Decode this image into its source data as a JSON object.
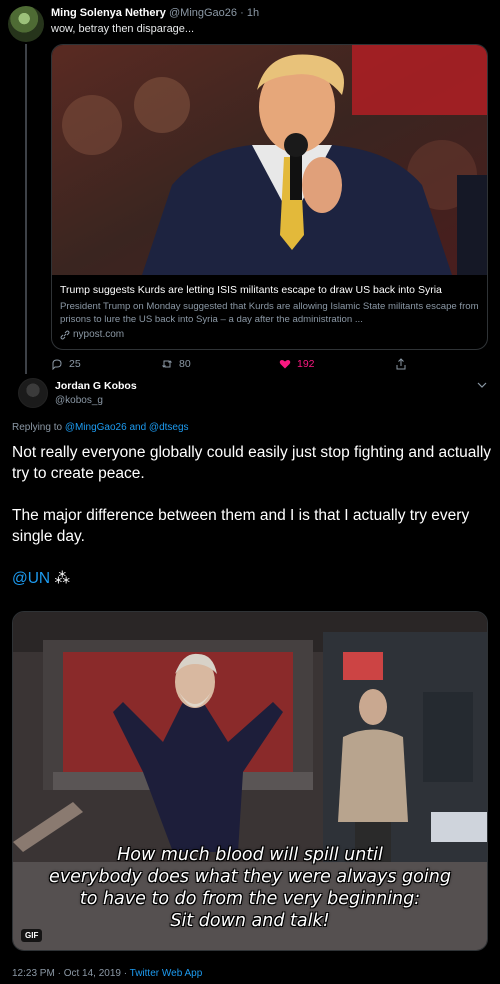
{
  "tweet1": {
    "name": "Ming Solenya Nethery",
    "handle": "@MingGao26",
    "time": "1h",
    "separator": "·",
    "text": "wow, betray then disparage...",
    "card": {
      "title": "Trump suggests Kurds are letting ISIS militants escape to draw US back into Syria",
      "description": "President Trump on Monday suggested that Kurds are allowing Islamic State militants escape from prisons to lure the US back into Syria – a day after the administration ...",
      "domain": "nypost.com"
    },
    "stats": {
      "replies": "25",
      "retweets": "80",
      "likes": "192"
    }
  },
  "tweet2": {
    "name": "Jordan G Kobos",
    "handle": "@kobos_g",
    "replying_prefix": "Replying to ",
    "replying_to_1": "@MingGao26",
    "replying_and": " and ",
    "replying_to_2": "@dtsegs",
    "text_p1": "Not really everyone globally could easily just stop fighting and actually try to create peace.",
    "text_p2": "The major difference between them and I is that I actually try every single day.",
    "mention": "@UN",
    "emoji": "⁂",
    "gif_caption_1": "How much blood will spill until",
    "gif_caption_2": "everybody does what they were always going",
    "gif_caption_3": "to have to do from the very beginning:",
    "gif_caption_4": "Sit down and talk!",
    "gif_badge": "GIF",
    "timestamp": "12:23 PM · Oct 14, 2019 · ",
    "source_app": "Twitter Web App"
  },
  "colors": {
    "accent": "#1d9bf0",
    "like": "#f91880",
    "muted": "#8b98a5",
    "background": "#000000"
  }
}
